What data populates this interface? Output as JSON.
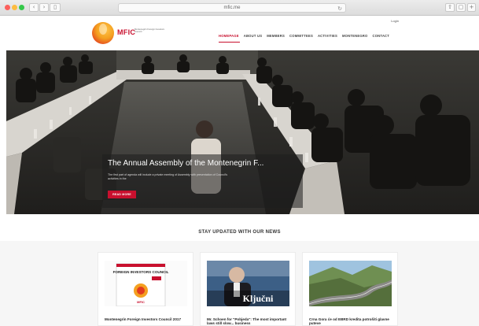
{
  "browser": {
    "url": "mfic.me",
    "back_icon": "chevron-left-icon",
    "forward_icon": "chevron-right-icon",
    "sidebar_icon": "sidebar-icon",
    "reload_icon": "reload-icon",
    "share_icon": "share-icon",
    "tabs_icon": "tabs-icon",
    "add_tab_icon": "plus-icon"
  },
  "header": {
    "login_label": "Login",
    "logo_text": "MFIC",
    "logo_sub": "Montenegrin Foreign Investors Council",
    "nav": [
      {
        "label": "HOMEPAGE",
        "active": true
      },
      {
        "label": "ABOUT US"
      },
      {
        "label": "MEMBERS"
      },
      {
        "label": "COMMITTEES"
      },
      {
        "label": "ACTIVITIES"
      },
      {
        "label": "MONTENEGRO"
      },
      {
        "label": "CONTACT"
      }
    ],
    "accent_color": "#c8102e"
  },
  "hero": {
    "title": "The Annual Assembly of the Montenegrin F...",
    "text": "The first part of agenda will include a private meeting of Assembly with presentation of Council's activities in the",
    "button_label": "READ MORE"
  },
  "news": {
    "section_title": "STAY UPDATED WITH OUR NEWS",
    "cards": [
      {
        "title": "Montenegrin Foreign Investors Council 2017",
        "image_alt": "brochure-cover",
        "image_text": "FOREIGN INVESTORS COUNCIL",
        "image_logo": "MFIC"
      },
      {
        "title": "Mr. Schoen for \"Pobjeda\": The most important laws still slow... business",
        "image_alt": "interview-photo",
        "image_text": "Ključni"
      },
      {
        "title": "Crna Gora će od EBRD kredita potrošiti glavne puteve",
        "image_alt": "mountain-road-photo"
      }
    ]
  }
}
